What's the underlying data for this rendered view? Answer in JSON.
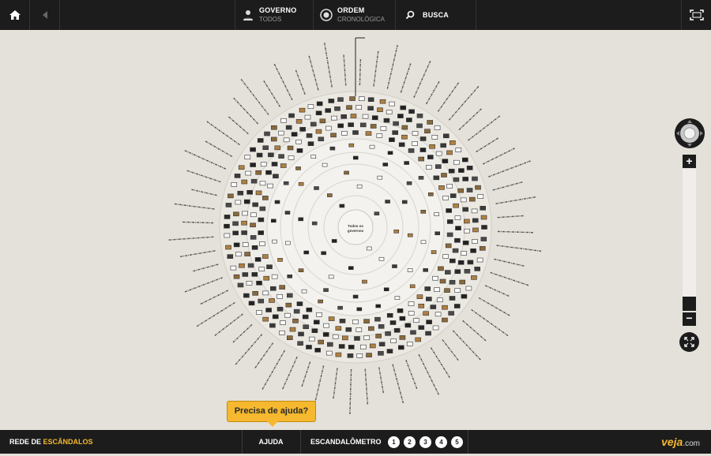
{
  "topbar": {
    "home_icon": "home-icon",
    "back_icon": "back-arrow-icon",
    "governo": {
      "label": "GOVERNO",
      "value": "TODOS",
      "icon": "person-icon"
    },
    "ordem": {
      "label": "ORDEM",
      "value": "CRONOLÓGICA",
      "icon": "sort-icon"
    },
    "busca": {
      "label": "BUSCA",
      "icon": "search-icon"
    },
    "fullscreen_icon": "fullscreen-icon"
  },
  "chart": {
    "center_label_line1": "Todos os",
    "center_label_line2": "governos",
    "accent": "#f5b82e"
  },
  "controls": {
    "zoom_in": "+",
    "zoom_out": "−",
    "pan_icon": "pan-joystick-icon",
    "expand_icon": "expand-icon"
  },
  "tooltip": {
    "text": "Precisa de ajuda?"
  },
  "bottombar": {
    "title_prefix": "REDE DE ",
    "title_highlight": "ESCÂNDALOS",
    "help": "AJUDA",
    "meter_label": "ESCANDALÔMETRO",
    "meter_levels": [
      "1",
      "2",
      "3",
      "4",
      "5"
    ],
    "brand": "veja",
    "brand_suffix": ".com"
  }
}
